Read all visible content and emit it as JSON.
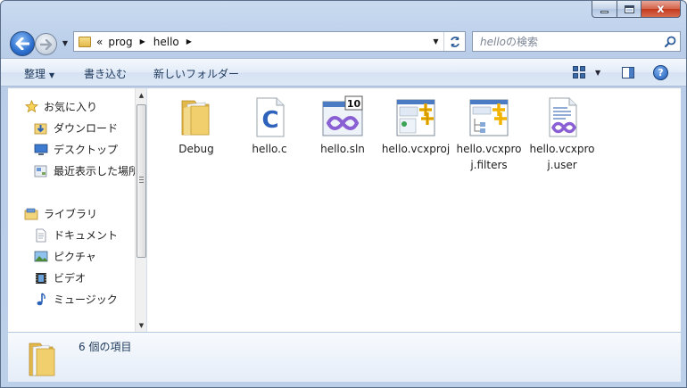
{
  "window": {
    "minimize_label": "",
    "maximize_label": "",
    "close_label": "x"
  },
  "address": {
    "overflow": "«",
    "crumbs": [
      "prog",
      "hello"
    ]
  },
  "search": {
    "italic_part": "hello",
    "rest": "の検索"
  },
  "toolbar": {
    "organize": "整理",
    "burn": "書き込む",
    "new_folder": "新しいフォルダー",
    "help": "?"
  },
  "nav": {
    "favorites": "お気に入り",
    "downloads": "ダウンロード",
    "desktop": "デスクトップ",
    "recent": "最近表示した場所",
    "libraries": "ライブラリ",
    "documents": "ドキュメント",
    "pictures": "ピクチャ",
    "videos": "ビデオ",
    "music": "ミュージック"
  },
  "files": [
    {
      "name": "Debug",
      "icon": "folder-icon"
    },
    {
      "name": "hello.c",
      "icon": "c-source-icon"
    },
    {
      "name": "hello.sln",
      "icon": "vs-solution-icon",
      "badge": "10"
    },
    {
      "name": "hello.vcxproj",
      "icon": "vcxproj-icon"
    },
    {
      "name": "hello.vcxproj.filters",
      "icon": "vcxproj-filters-icon"
    },
    {
      "name": "hello.vcxproj.user",
      "icon": "vcxproj-user-icon"
    }
  ],
  "status": {
    "count_text": "6 個の項目"
  },
  "colors": {
    "accent": "#2c6fcf",
    "folder": "#e3b84a",
    "vs_purple": "#8a5fd3",
    "toolbar_text": "#1e395b"
  }
}
